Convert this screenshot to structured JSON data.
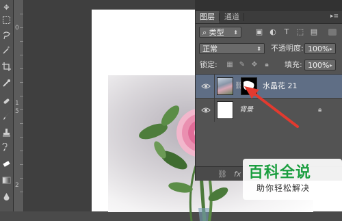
{
  "tools": [
    "move-tool",
    "marquee-tool",
    "lasso-tool",
    "magic-wand-tool",
    "crop-tool",
    "eyedropper-tool",
    "healing-brush-tool",
    "brush-tool",
    "clone-stamp-tool",
    "history-brush-tool",
    "eraser-tool",
    "gradient-tool",
    "blur-tool"
  ],
  "ruler": {
    "marks": [
      "0",
      "1",
      "5",
      "2"
    ]
  },
  "layers_panel": {
    "tabs": {
      "layers": "图层",
      "channels": "通道"
    },
    "filter": {
      "kind_label": "类型"
    },
    "blend": {
      "mode": "正常",
      "opacity_label": "不透明度:",
      "opacity_value": "100%"
    },
    "lock": {
      "label": "锁定:",
      "fill_label": "填充:",
      "fill_value": "100%"
    },
    "layers": [
      {
        "name": "水晶花 21",
        "selected": true
      },
      {
        "name": "背景",
        "selected": false
      }
    ]
  },
  "watermark": {
    "title": "百科全说",
    "subtitle": "助你轻松解决"
  },
  "colors": {
    "arrow": "#e23a2f",
    "selected_layer": "#5f6e85",
    "watermark_green": "#1a9e3f"
  }
}
